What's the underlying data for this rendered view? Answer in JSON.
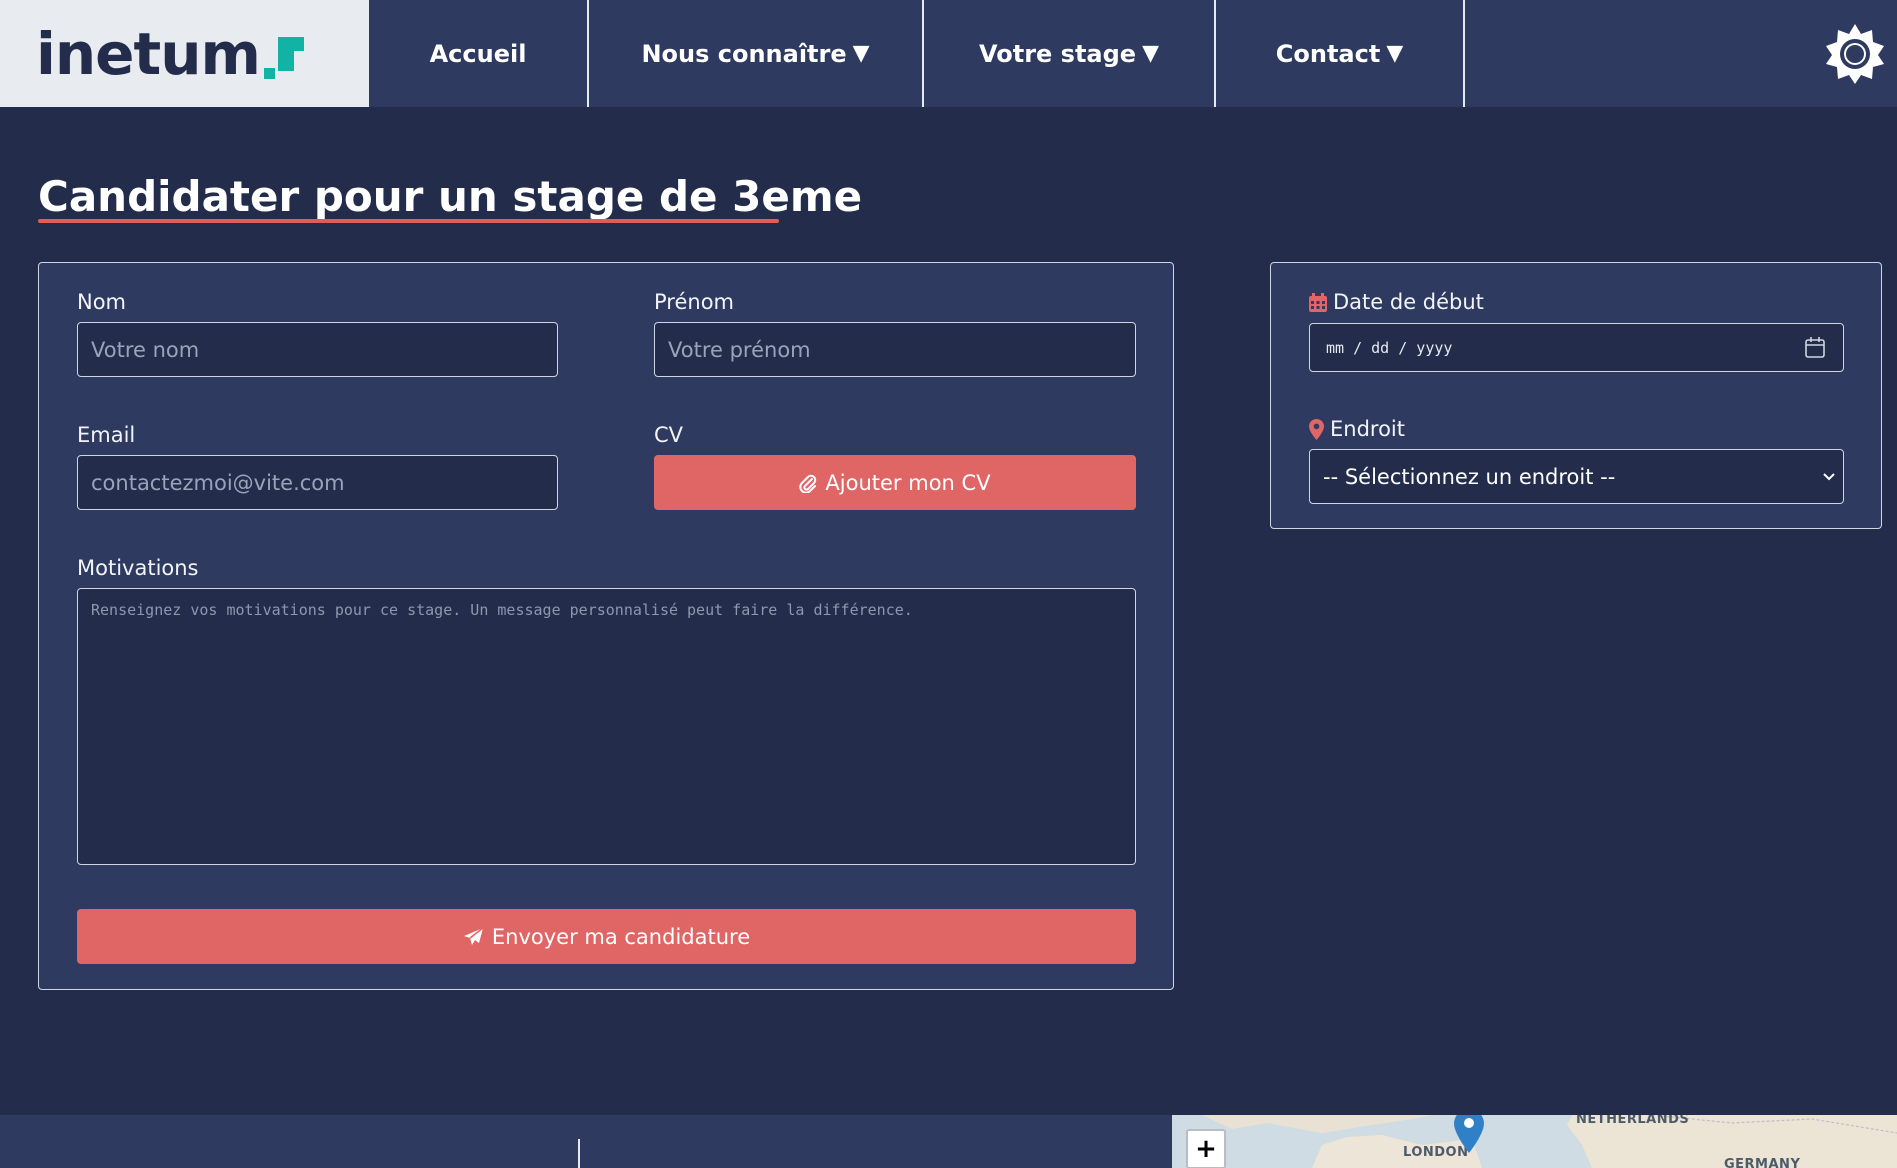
{
  "nav": {
    "logo_text": "inetum",
    "items": [
      {
        "label": "Accueil",
        "has_arrow": false
      },
      {
        "label": "Nous connaître",
        "has_arrow": true
      },
      {
        "label": "Votre stage",
        "has_arrow": true
      },
      {
        "label": "Contact",
        "has_arrow": true
      }
    ],
    "arrow_glyph": "▼",
    "theme_icon": "sun-icon"
  },
  "page": {
    "title": "Candidater pour un stage de 3eme"
  },
  "form": {
    "nom_label": "Nom",
    "nom_placeholder": "Votre nom",
    "prenom_label": "Prénom",
    "prenom_placeholder": "Votre prénom",
    "email_label": "Email",
    "email_placeholder": "contactezmoi@vite.com",
    "cv_label": "CV",
    "cv_button": "Ajouter mon CV",
    "motivations_label": "Motivations",
    "motivations_placeholder": "Renseignez vos motivations pour ce stage. Un message personnalisé peut faire la différence.",
    "submit_button": "Envoyer ma candidature"
  },
  "side": {
    "date_label": "Date de début",
    "date_placeholder": "mm / dd / yyyy",
    "location_label": "Endroit",
    "location_selected": "-- Sélectionnez un endroit --"
  },
  "map": {
    "zoom_in": "+",
    "labels": [
      "NETHERLANDS",
      "LONDON",
      "GERMANY"
    ]
  },
  "colors": {
    "background": "#232d4b",
    "panel": "#2e3a5f",
    "accent": "#e06666",
    "logo_teal": "#12b3a5"
  }
}
